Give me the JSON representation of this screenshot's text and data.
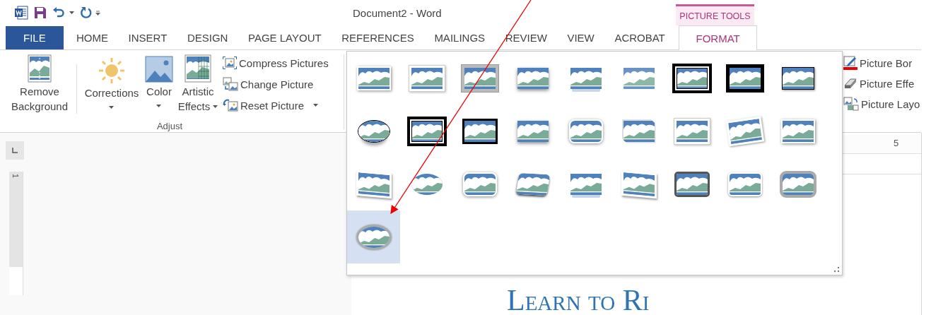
{
  "window": {
    "title": "Document2 - Word"
  },
  "contextual_tab_group": {
    "label": "PICTURE TOOLS"
  },
  "tabs": [
    {
      "label": "FILE",
      "kind": "file",
      "selected": false
    },
    {
      "label": "HOME",
      "kind": "normal",
      "selected": false
    },
    {
      "label": "INSERT",
      "kind": "normal",
      "selected": false
    },
    {
      "label": "DESIGN",
      "kind": "normal",
      "selected": false
    },
    {
      "label": "PAGE LAYOUT",
      "kind": "normal",
      "selected": false
    },
    {
      "label": "REFERENCES",
      "kind": "normal",
      "selected": false
    },
    {
      "label": "MAILINGS",
      "kind": "normal",
      "selected": false
    },
    {
      "label": "REVIEW",
      "kind": "normal",
      "selected": false
    },
    {
      "label": "VIEW",
      "kind": "normal",
      "selected": false
    },
    {
      "label": "ACROBAT",
      "kind": "normal",
      "selected": false
    },
    {
      "label": "FORMAT",
      "kind": "contextual",
      "selected": true
    }
  ],
  "adjust_group": {
    "label": "Adjust",
    "large_buttons": [
      {
        "kind": "remove-background",
        "label": "Remove Background",
        "dropdown": false
      },
      {
        "kind": "corrections",
        "label": "Corrections",
        "dropdown": true
      },
      {
        "kind": "color",
        "label": "Color",
        "dropdown": true
      },
      {
        "kind": "artistic-effects",
        "label": "Artistic Effects",
        "dropdown": true
      }
    ],
    "small_buttons": [
      {
        "kind": "compress",
        "label": "Compress Pictures",
        "dropdown": false
      },
      {
        "kind": "change",
        "label": "Change Picture",
        "dropdown": false
      },
      {
        "kind": "reset",
        "label": "Reset Picture",
        "dropdown": true
      }
    ]
  },
  "picture_styles_gallery": {
    "styles": [
      {
        "kind": "shadow",
        "selected": false
      },
      {
        "kind": "white-frame",
        "selected": false
      },
      {
        "kind": "gray-frame",
        "selected": false
      },
      {
        "kind": "soft-shadow",
        "selected": false
      },
      {
        "kind": "reflection",
        "selected": false
      },
      {
        "kind": "soft-edge",
        "selected": false
      },
      {
        "kind": "double-frame",
        "selected": false
      },
      {
        "kind": "black-frame",
        "selected": false
      },
      {
        "kind": "thin-black",
        "selected": false
      },
      {
        "kind": "oval-shadow",
        "selected": false
      },
      {
        "kind": "double-frame",
        "selected": false
      },
      {
        "kind": "thick-black",
        "selected": false
      },
      {
        "kind": "soft-shadow",
        "selected": false
      },
      {
        "kind": "rounded",
        "selected": false
      },
      {
        "kind": "snipped",
        "selected": false
      },
      {
        "kind": "white-frame",
        "selected": false
      },
      {
        "kind": "rotated",
        "selected": false
      },
      {
        "kind": "shadow",
        "selected": false
      },
      {
        "kind": "perspective",
        "selected": false
      },
      {
        "kind": "soft-oval",
        "selected": false
      },
      {
        "kind": "rounded",
        "selected": false
      },
      {
        "kind": "tilted",
        "selected": false
      },
      {
        "kind": "reflection",
        "selected": false
      },
      {
        "kind": "perspective",
        "selected": false
      },
      {
        "kind": "dark-rounded",
        "selected": false
      },
      {
        "kind": "rounded-reflection",
        "selected": false
      },
      {
        "kind": "bevel-rounded",
        "selected": false
      },
      {
        "kind": "bevel-oval",
        "selected": true
      }
    ]
  },
  "picture_format_buttons": [
    {
      "kind": "border",
      "label": "Picture Bor"
    },
    {
      "kind": "effects",
      "label": "Picture Effe"
    },
    {
      "kind": "layout",
      "label": "Picture Layo"
    }
  ],
  "horizontal_ruler": {
    "label": "5"
  },
  "vertical_ruler": {
    "label": "1"
  },
  "document": {
    "heading": "Learn to Ri"
  }
}
